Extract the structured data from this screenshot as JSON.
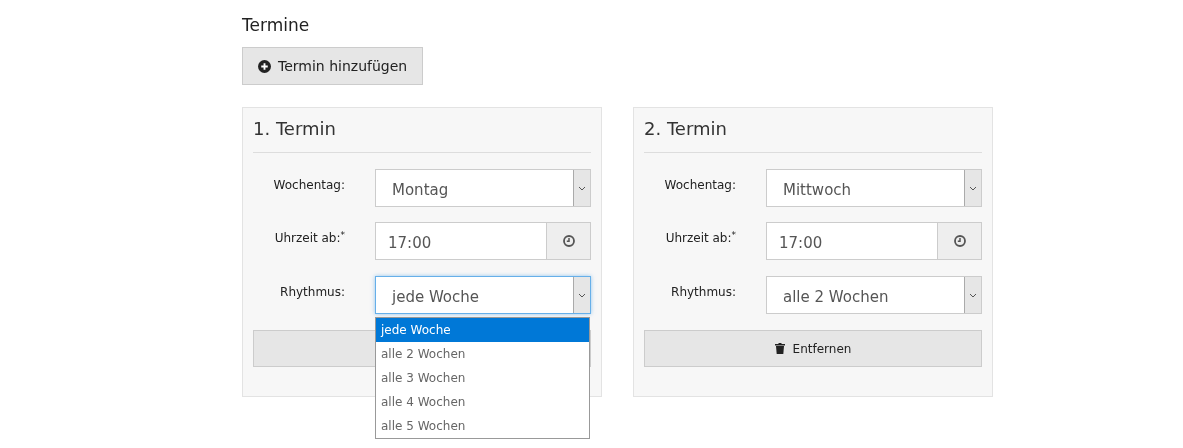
{
  "section_title": "Termine",
  "add_button": {
    "label": "Termin hinzufügen"
  },
  "appointments": [
    {
      "title": "1. Termin",
      "weekday": {
        "label": "Wochentag:",
        "value": "Montag"
      },
      "time": {
        "label": "Uhrzeit ab:$^{*}$",
        "value": "17:00"
      },
      "rhythm": {
        "label": "Rhythmus:",
        "value": "jede Woche",
        "focused": true,
        "options": [
          {
            "label": "jede Woche",
            "selected": true
          },
          {
            "label": "alle 2 Wochen",
            "selected": false
          },
          {
            "label": "alle 3 Wochen",
            "selected": false
          },
          {
            "label": "alle 4 Wochen",
            "selected": false
          },
          {
            "label": "alle 5 Wochen",
            "selected": false
          }
        ]
      }
    },
    {
      "title": "2. Termin",
      "weekday": {
        "label": "Wochentag:",
        "value": "Mittwoch"
      },
      "time": {
        "label": "Uhrzeit ab:$^{*}$",
        "value": "17:00"
      },
      "rhythm": {
        "label": "Rhythmus:",
        "value": "alle 2 Wochen",
        "focused": false
      },
      "remove_button": {
        "label": "Entfernen"
      }
    }
  ]
}
